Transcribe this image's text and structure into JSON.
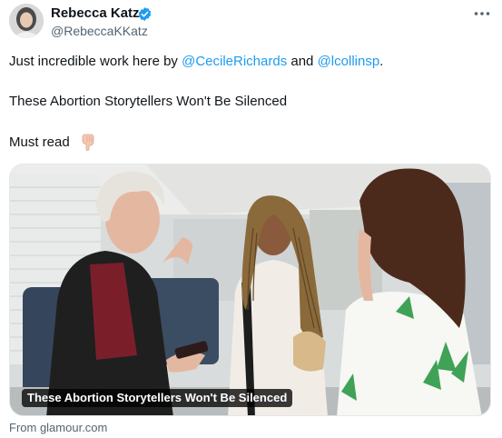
{
  "author": {
    "name": "Rebecca Katz",
    "handle": "@RebeccaKKatz",
    "avatar_icon": "user-avatar",
    "verified_icon": "verified-badge-icon"
  },
  "more_icon": "more-options-icon",
  "tweet": {
    "line1_prefix": "Just incredible work here by",
    "mention1": "@CecileRichards",
    "line1_and": "and",
    "mention2": "@lcollinsp",
    "line1_suffix": ".",
    "line2": "These Abortion Storytellers Won't Be Silenced",
    "line3": "Must read",
    "emoji_icon": "backhand-index-pointing-down-icon"
  },
  "card": {
    "caption": "These Abortion Storytellers Won't Be Silenced",
    "source": "From glamour.com"
  },
  "colors": {
    "link": "#1d9bf0",
    "secondary_text": "#536471",
    "verified": "#1d9bf0"
  }
}
